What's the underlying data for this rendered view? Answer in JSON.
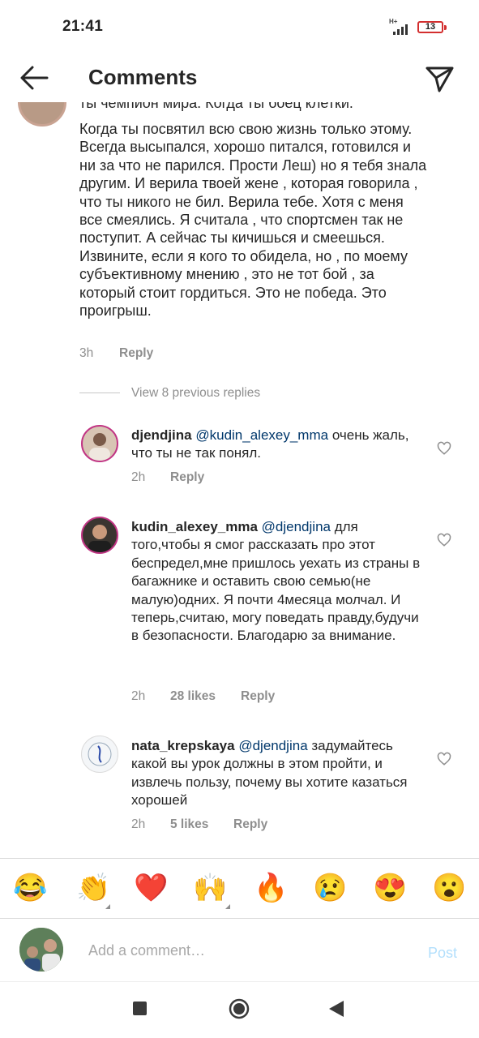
{
  "status_bar": {
    "time": "21:41",
    "network": "H+",
    "battery": "13"
  },
  "header": {
    "title": "Comments",
    "back_icon": "arrow-left-icon",
    "send_icon": "paper-plane-icon"
  },
  "main_comment": {
    "cut_line": "ты чемпион мира. Когда ты боец клетки.",
    "text": "Когда ты посвятил всю свою жизнь только этому. Всегда высыпался, хорошо питался, готовился и ни за что не парился. Прости Леш) но я тебя знала другим.  И верила твоей жене , которая говорила , что ты никого не бил. Верила тебе. Хотя с меня все смеялись. Я считала , что спортсмен так не поступит. А сейчас ты кичишься и смеешься. Извините, если я кого то обидела, но , по моему субъективному мнению , это не тот бой , за который стоит гордиться. Это не победа. Это проигрыш.",
    "time": "3h",
    "reply_label": "Reply"
  },
  "view_previous": "View 8 previous replies",
  "replies": [
    {
      "username": "djendjina",
      "mention": "@kudin_alexey_mma",
      "text": " очень жаль, что ты не так понял.",
      "time": "2h",
      "likes": "",
      "reply_label": "Reply"
    },
    {
      "username": "kudin_alexey_mma",
      "mention": "@djendjina",
      "text": " для того,чтобы я смог рассказать про этот беспредел,мне пришлось уехать из страны в багажнике и оставить свою семью(не малую)одних. Я почти 4месяца молчал. И теперь,считаю, могу поведать правду,будучи в безопасности. Благодарю за внимание.",
      "time": "2h",
      "likes": "28 likes",
      "reply_label": "Reply"
    },
    {
      "username": "nata_krepskaya",
      "mention": "@djendjina",
      "text": " задумайтесь какой вы урок должны в этом пройти, и извлечь пользу, почему вы хотите казаться хорошей",
      "time": "2h",
      "likes": "5 likes",
      "reply_label": "Reply"
    }
  ],
  "emoji_bar": [
    "😂",
    "👏",
    "❤️",
    "🙌",
    "🔥",
    "😢",
    "😍",
    "😮"
  ],
  "comment_input": {
    "placeholder": "Add a comment…",
    "post_label": "Post"
  },
  "colors": {
    "text": "#262626",
    "secondary": "#8e8e8e",
    "mention": "#00376b",
    "post_disabled": "#b2dffc",
    "battery_border": "#d32f2f"
  }
}
